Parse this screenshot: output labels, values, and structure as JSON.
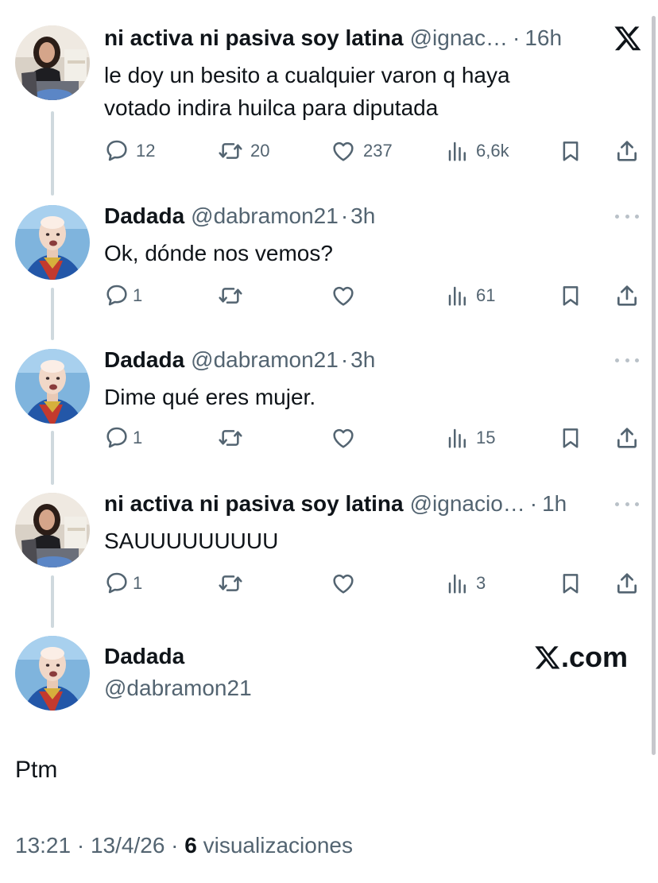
{
  "tweets": [
    {
      "name": "ni activa ni pasiva soy latina",
      "handle": "@ignac…",
      "time": "16h",
      "text_lines": [
        "le doy un besito a cualquier varon q haya",
        "votado indira huilca para diputada"
      ],
      "replies": "12",
      "retweets": "20",
      "likes": "237",
      "views": "6,6k",
      "avatar": "woman-avatar"
    },
    {
      "name": "Dadada",
      "handle": "@dabramon21",
      "time": "3h",
      "text_lines": [
        "Ok, dónde nos vemos?"
      ],
      "replies": "1",
      "retweets": "",
      "likes": "",
      "views": "61",
      "avatar": "bald-man-avatar"
    },
    {
      "name": "Dadada",
      "handle": "@dabramon21",
      "time": "3h",
      "text_lines": [
        "Dime qué eres mujer."
      ],
      "replies": "1",
      "retweets": "",
      "likes": "",
      "views": "15",
      "avatar": "bald-man-avatar"
    },
    {
      "name": "ni activa ni pasiva soy latina",
      "handle": "@ignacio…",
      "time": "1h",
      "text_lines": [
        "SAUUUUUUUUU"
      ],
      "replies": "1",
      "retweets": "",
      "likes": "",
      "views": "3",
      "avatar": "woman-avatar"
    }
  ],
  "main_tweet": {
    "name": "Dadada",
    "handle": "@dabramon21",
    "text": "Ptm",
    "time": "13:21",
    "date": "13/4/26",
    "views_count": "6",
    "views_label": "visualizaciones",
    "watermark": ".com"
  },
  "dot": "·",
  "colors": {
    "text": "#0f1419",
    "secondary": "#536471",
    "thread_line": "#cfd9de"
  },
  "icons": [
    "x-logo-icon",
    "reply-icon",
    "retweet-icon",
    "like-icon",
    "views-icon",
    "bookmark-icon",
    "share-icon",
    "more-icon"
  ]
}
